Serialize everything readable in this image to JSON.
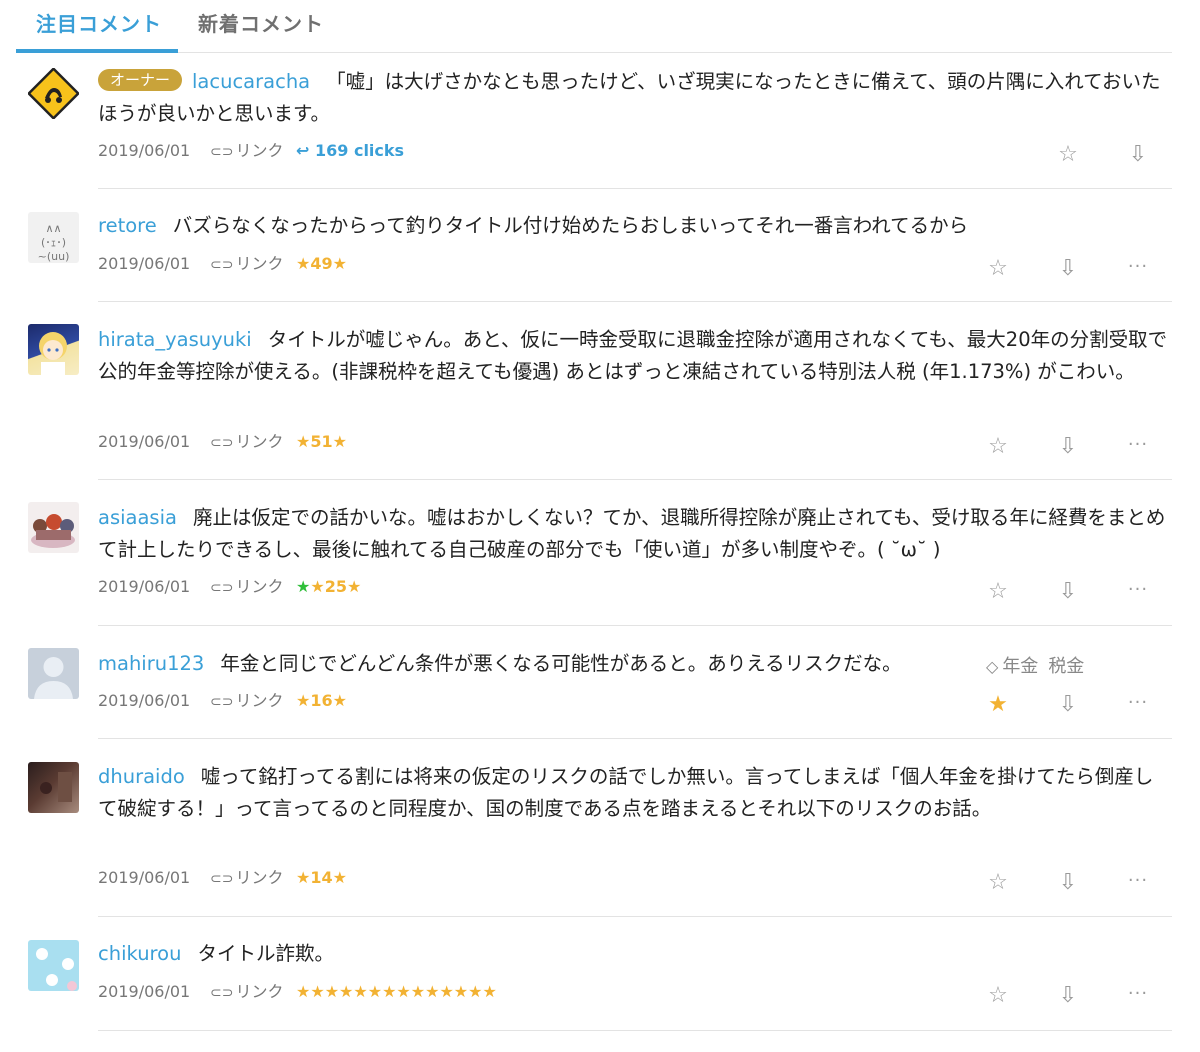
{
  "tabs": {
    "featured": "注目コメント",
    "latest": "新着コメント"
  },
  "comments": [
    {
      "user": "lacucaracha",
      "badge": "オーナー",
      "text": "「嘘」は大げさかなとも思ったけど、いざ現実になったときに備えて、頭の片隅に入れておいたほうが良いかと思います。",
      "date": "2019/06/01",
      "link_label": "リンク",
      "clicks": "169 clicks"
    },
    {
      "user": "retore",
      "text": "バズらなくなったからって釣りタイトル付け始めたらおしまいってそれ一番言われてるから",
      "date": "2019/06/01",
      "link_label": "リンク",
      "stars_count": "49"
    },
    {
      "user": "hirata_yasuyuki",
      "text": "タイトルが嘘じゃん。あと、仮に一時金受取に退職金控除が適用されなくても、最大20年の分割受取で公的年金等控除が使える。(非課税枠を超えても優遇) あとはずっと凍結されている特別法人税 (年1.173%) がこわい。",
      "date": "2019/06/01",
      "link_label": "リンク",
      "stars_count": "51"
    },
    {
      "user": "asiaasia",
      "text": "廃止は仮定での話かいな。嘘はおかしくない？てか、退職所得控除が廃止されても、受け取る年に経費をまとめて計上したりできるし、最後に触れてる自己破産の部分でも「使い道」が多い制度やぞ。( ˘ω˘ )",
      "date": "2019/06/01",
      "link_label": "リンク",
      "stars_count": "25"
    },
    {
      "user": "mahiru123",
      "text": "年金と同じでどんどん条件が悪くなる可能性があると。ありえるリスクだな。",
      "date": "2019/06/01",
      "link_label": "リンク",
      "stars_count": "16",
      "tags": [
        "年金",
        "税金"
      ]
    },
    {
      "user": "dhuraido",
      "text": "嘘って銘打ってる割には将来の仮定のリスクの話でしか無い。言ってしまえば「個人年金を掛けてたら倒産して破綻する！」って言ってるのと同程度か、国の制度である点を踏まえるとそれ以下のリスクのお話。",
      "date": "2019/06/01",
      "link_label": "リンク",
      "stars_count": "14"
    },
    {
      "user": "chikurou",
      "text": "タイトル詐欺。",
      "date": "2019/06/01",
      "link_label": "リンク",
      "stars_count": "14"
    }
  ],
  "colors": {
    "accent": "#3a9fd7",
    "star": "#f2b233",
    "green_star": "#2fbf3a",
    "owner_badge": "#c9a33a"
  }
}
